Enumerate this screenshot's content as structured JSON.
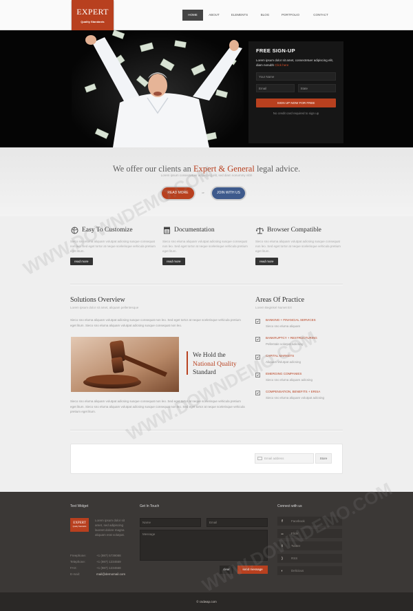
{
  "logo": {
    "name": "EXPERT",
    "tagline": "Quality Standards"
  },
  "nav": {
    "items": [
      "HOME",
      "ABOUT",
      "ELEMENTS",
      "BLOG",
      "PORTFOLIO",
      "CONTACT"
    ],
    "active_index": 0
  },
  "signup": {
    "title": "FREE SIGN-UP",
    "desc": "Lorem ipsum dolor sit amet, consectetuer adipiscing elit, diam nonubh",
    "link": "Click here",
    "name_placeholder": "Your Name",
    "email_placeholder": "Email",
    "state_placeholder": "State",
    "button": "SIGN UP NOW FOR FREE",
    "note": "No credit card required to sign up"
  },
  "intro": {
    "title_pre": "We offer our clients an",
    "title_hl": "Expert & General",
    "title_post": "legal advice.",
    "subtitle": "Lorem ipsum consectetuer adipiscing elit, sed diam nonummy nibh",
    "read_more": "READ MORE",
    "or": "or",
    "join": "JOIN WITH US"
  },
  "features": [
    {
      "icon": "globe-icon",
      "title": "Easy To Customize",
      "body": "Sieco sno eluma aliquam volutpat adicsing susque consequat non leo. Sed eget tortor at neque scelerisque vehicula pretium eget litum.",
      "button": "read more"
    },
    {
      "icon": "document-icon",
      "title": "Documentation",
      "body": "Sieco sno eluma aliquam volutpat adicsing susque consequat non leo. Sed eget tortor at neque scelerisque vehicula pretium eget litum.",
      "button": "read more"
    },
    {
      "icon": "scales-icon",
      "title": "Browser Compatible",
      "body": "Sieco sno eluma aliquam volutpat adicsing susque consequat non leo. Sed eget tortor at neque scelerisque vehicula pretium eget litum.",
      "button": "read more"
    }
  ],
  "solutions": {
    "title": "Solutions Overview",
    "subtitle": "Lorem ipsum dolor sit amet, aliquam pellentesque",
    "para1": "Sieco sno eluma aliquam volutpat adicsing susque consequat non leo. Sed eget tortor at neque scelerisque vehicula pretium eget litum. Sieco sno eluma aliquam volutpat adicsing susque consequat non leo.",
    "quote_pre": "We Hold the",
    "quote_hl": "National Quality",
    "quote_post": "Standard",
    "para2": "Sieco sno eluma aliquam volutpat adicsing susque consequat non leo. Sed eget tortor at neque scelerisque vehicula pretium eget litum. Sieco sno eluma aliquam volutpat adicsing susque consequat non leo. Sed eget tortor at neque scelerisque vehicula pretium eget litum."
  },
  "practice": {
    "title": "Areas Of Practice",
    "subtitle": "Lorem Beginkel Numet Ert",
    "items": [
      {
        "title": "BANKING + FINANCIAL SERVICES",
        "desc": "Sieco sno eluma aliquam"
      },
      {
        "title": "BANKRUPTCY + RESTRUCTURING",
        "desc": "Pellentale volutpat adicsing"
      },
      {
        "title": "CAPITAL MARKETS",
        "desc": "Aliquam volutpat adicsing"
      },
      {
        "title": "EMERGING COMPANIES",
        "desc": "Sieco sno eluma aliquam adicsing"
      },
      {
        "title": "COMPENSATION, BENEFITS + ERISA",
        "desc": "Sieco sno eluma aliquam volutpat adicsing"
      }
    ]
  },
  "newsletter": {
    "placeholder": "Email address",
    "button": "Store"
  },
  "footer": {
    "text_widget_title": "Text Widget",
    "text_widget_body": "Lorem ipsum dolor sit amet, sed adipiscing laoreet dolore magna aliquam erat volutpat.",
    "logo_name": "EXPERT",
    "logo_tag": "Quality Standards",
    "contacts": [
      {
        "label": "Freephone:",
        "value": "+1 (987) 5739088"
      },
      {
        "label": "Telephone:",
        "value": "+1 (987) 1234569"
      },
      {
        "label": "FAX:",
        "value": "+1 (987) 1234568"
      },
      {
        "label": "E-mail:",
        "value": "mail@demomail.com"
      }
    ],
    "touch_title": "Get In Touch",
    "name_placeholder": "Name",
    "email_placeholder": "Email",
    "message_placeholder": "Message",
    "clear": "clear",
    "send": "send message",
    "connect_title": "Connect with us",
    "social": [
      {
        "icon": "facebook-icon",
        "glyph": "f",
        "label": "Facebook"
      },
      {
        "icon": "flickr-icon",
        "glyph": "●●",
        "label": "Flickr"
      },
      {
        "icon": "twitter-icon",
        "glyph": "t",
        "label": "Twitter"
      },
      {
        "icon": "rss-icon",
        "glyph": ")",
        "label": "RSS"
      },
      {
        "icon": "delicious-icon",
        "glyph": "◐",
        "label": "Delicious"
      }
    ],
    "copyright": "© csdwap.com"
  },
  "watermark": "WWW.DOWNDEMO.COM",
  "colors": {
    "accent": "#b8401f",
    "blue": "#3e5a8c",
    "dark": "#3b3836"
  }
}
